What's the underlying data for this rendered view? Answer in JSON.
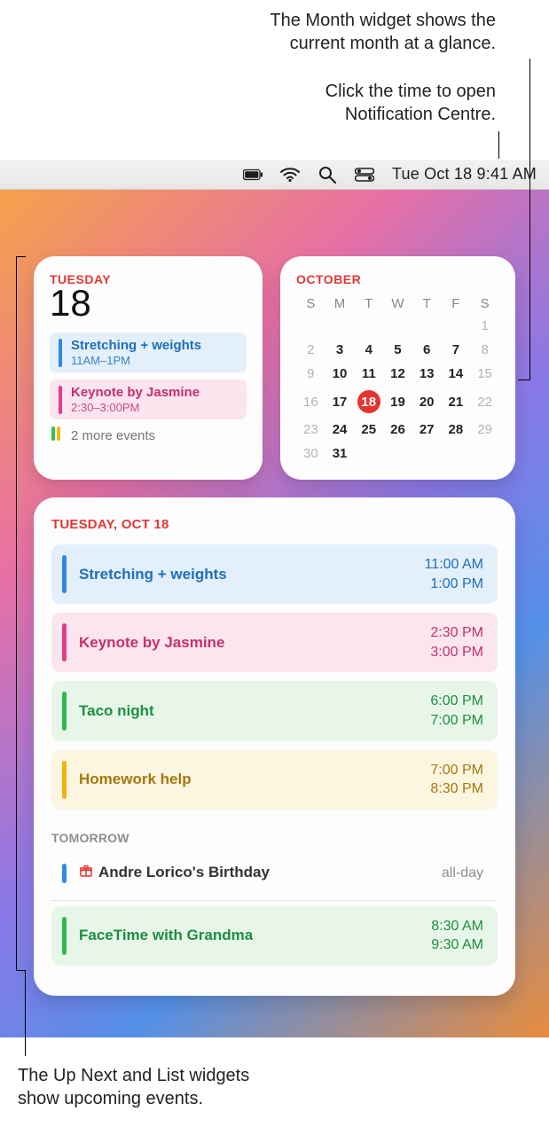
{
  "callouts": {
    "month_l1": "The Month widget shows the",
    "month_l2": "current month at a glance.",
    "clock_l1": "Click the time to open",
    "clock_l2": "Notification Centre.",
    "bottom_l1": "The Up Next and List widgets",
    "bottom_l2": "show upcoming events."
  },
  "menubar": {
    "clock": "Tue Oct 18  9:41 AM"
  },
  "upnext": {
    "dow": "Tuesday",
    "daynum": "18",
    "events": {
      "e0_title": "Stretching + weights",
      "e0_time": "11AM–1PM",
      "e1_title": "Keynote by Jasmine",
      "e1_time": "2:30–3:00PM"
    },
    "more": "2 more events"
  },
  "month": {
    "title": "October",
    "dows": {
      "d0": "S",
      "d1": "M",
      "d2": "T",
      "d3": "W",
      "d4": "T",
      "d5": "F",
      "d6": "S"
    }
  },
  "chart_data": {
    "type": "table",
    "title": "October",
    "columns": [
      "S",
      "M",
      "T",
      "W",
      "T",
      "F",
      "S"
    ],
    "today": 18,
    "rows": [
      [
        "",
        "",
        "",
        "",
        "",
        "",
        1
      ],
      [
        2,
        3,
        4,
        5,
        6,
        7,
        8
      ],
      [
        9,
        10,
        11,
        12,
        13,
        14,
        15
      ],
      [
        16,
        17,
        18,
        19,
        20,
        21,
        22
      ],
      [
        23,
        24,
        25,
        26,
        27,
        28,
        29
      ],
      [
        30,
        31,
        "",
        "",
        "",
        "",
        ""
      ]
    ],
    "dim_columns_index": [
      0,
      6
    ]
  },
  "list": {
    "section1": "Tuesday, Oct 18",
    "section2": "Tomorrow",
    "today": {
      "e0_title": "Stretching + weights",
      "e0_t1": "11:00 AM",
      "e0_t2": "1:00 PM",
      "e1_title": "Keynote by Jasmine",
      "e1_t1": "2:30 PM",
      "e1_t2": "3:00 PM",
      "e2_title": "Taco night",
      "e2_t1": "6:00 PM",
      "e2_t2": "7:00 PM",
      "e3_title": "Homework help",
      "e3_t1": "7:00 PM",
      "e3_t2": "8:30 PM"
    },
    "tomorrow": {
      "b0_title": "Andre Lorico's Birthday",
      "b0_time": "all-day",
      "b1_title": "FaceTime with Grandma",
      "b1_t1": "8:30 AM",
      "b1_t2": "9:30 AM"
    }
  }
}
